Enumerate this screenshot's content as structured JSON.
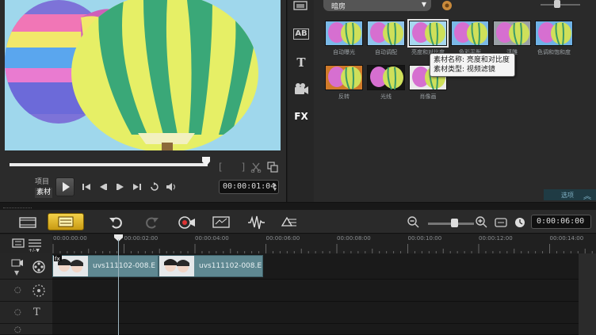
{
  "preview": {
    "mode_project": "项目",
    "mode_clip": "素材",
    "timecode": "00:00:01:04",
    "trim_marks": "[ ]"
  },
  "library": {
    "category": "暗房",
    "thumbnails": [
      {
        "label": "自动曝光",
        "tint": "#7ab9e8"
      },
      {
        "label": "自动调配",
        "tint": "#8fc4ea"
      },
      {
        "label": "亮度和对比度",
        "tint": "#a7d8ef",
        "selected": true
      },
      {
        "label": "色彩平衡",
        "tint": "#7bb8e6"
      },
      {
        "label": "浮雕",
        "tint": "#9aa1a6"
      },
      {
        "label": "色调和饱和度",
        "tint": "#6fb2e6"
      },
      {
        "label": "反转",
        "tint": "#d07a2a"
      },
      {
        "label": "光线",
        "tint": "#151515"
      },
      {
        "label": "肖像画",
        "tint": "#eaeaea"
      }
    ],
    "tooltip": {
      "line1": "素材名称: 亮度和对比度",
      "line2": "素材类型: 视频滤镜"
    },
    "options_label": "选项"
  },
  "side_tabs": [
    "media-tab",
    "transition-tab",
    "title-tab",
    "graphic-tab",
    "filter-tab"
  ],
  "side_tab_labels": {
    "title": "T",
    "filter": "FX",
    "transition": "AB"
  },
  "timeline": {
    "duration": "0:00:06:00",
    "ruler": [
      "00:00:00:00",
      "00:00:02:00",
      "00:00:04:00",
      "00:00:06:00",
      "00:00:08:00",
      "00:00:10:00",
      "00:00:12:00",
      "00:00:14:00"
    ],
    "clips": [
      {
        "name": "uvs111102-008.E"
      },
      {
        "name": "uvs111102-008.E"
      }
    ],
    "playhead_time": "00:00:01:04",
    "track_title_label": "T"
  },
  "colors": {
    "accent": "#f3d24a",
    "clip": "#5f8891",
    "panel": "#2a2a2a"
  }
}
